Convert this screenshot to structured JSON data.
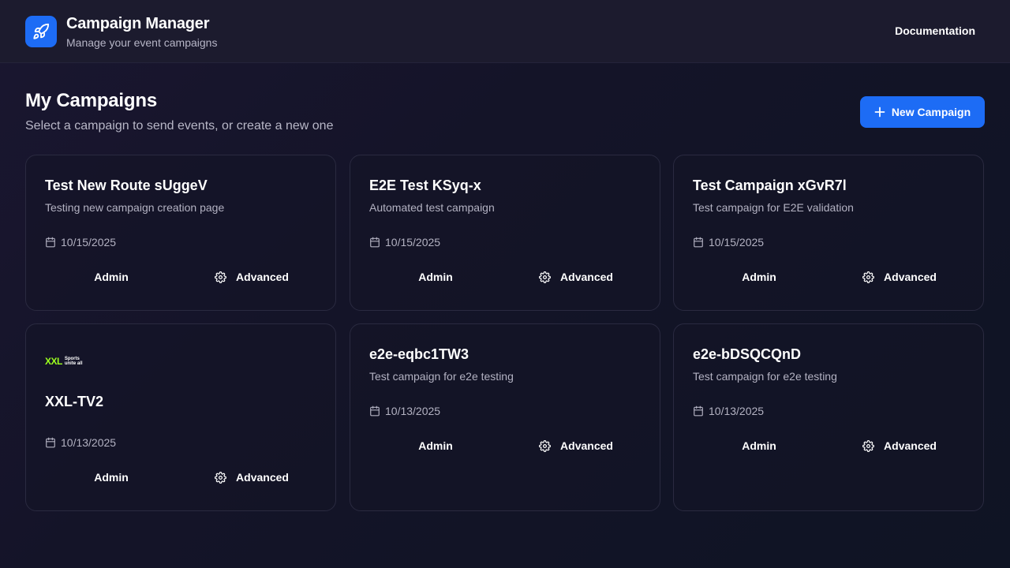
{
  "header": {
    "app_title": "Campaign Manager",
    "app_subtitle": "Manage your event campaigns",
    "logo_icon": "rocket-icon",
    "documentation_label": "Documentation"
  },
  "main": {
    "title": "My Campaigns",
    "subtitle": "Select a campaign to send events, or create a new one",
    "new_campaign_label": "New Campaign"
  },
  "campaigns": [
    {
      "title": "Test New Route sUggeV",
      "description": "Testing new campaign creation page",
      "date": "10/15/2025",
      "admin_label": "Admin",
      "advanced_label": "Advanced"
    },
    {
      "title": "E2E Test KSyq-x",
      "description": "Automated test campaign",
      "date": "10/15/2025",
      "admin_label": "Admin",
      "advanced_label": "Advanced"
    },
    {
      "title": "Test Campaign xGvR7l",
      "description": "Test campaign for E2E validation",
      "date": "10/15/2025",
      "admin_label": "Admin",
      "advanced_label": "Advanced"
    },
    {
      "title": "XXL-TV2",
      "logo_text": "XXL",
      "logo_tagline_1": "Sports",
      "logo_tagline_2": "unite all",
      "date": "10/13/2025",
      "admin_label": "Admin",
      "advanced_label": "Advanced"
    },
    {
      "title": "e2e-eqbc1TW3",
      "description": "Test campaign for e2e testing",
      "date": "10/13/2025",
      "admin_label": "Admin",
      "advanced_label": "Advanced"
    },
    {
      "title": "e2e-bDSQCQnD",
      "description": "Test campaign for e2e testing",
      "date": "10/13/2025",
      "admin_label": "Admin",
      "advanced_label": "Advanced"
    }
  ],
  "colors": {
    "accent": "#1d6cf5",
    "brand_green": "#9cff1e",
    "background": "#141428"
  }
}
